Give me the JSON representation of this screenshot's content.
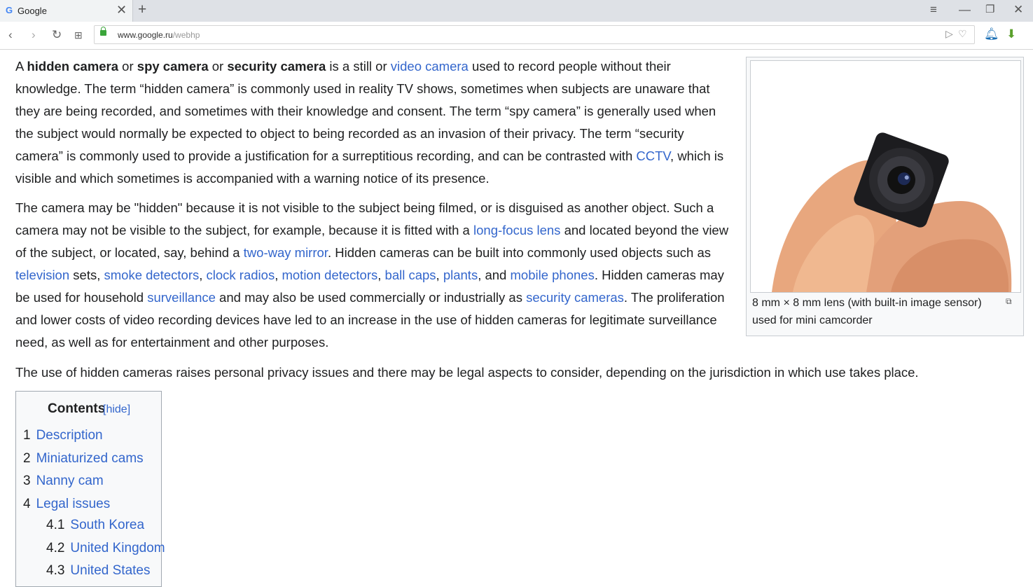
{
  "browser": {
    "tab_title": "Google",
    "tab_favicon": "G",
    "url_host": "www.google.ru",
    "url_path": "/webhp"
  },
  "article": {
    "p1": {
      "s1": "A ",
      "b1": "hidden camera",
      "s2": " or ",
      "b2": "spy camera",
      "s3": " or ",
      "b3": "security camera",
      "s4": " is a still or ",
      "l1": "video camera",
      "s5": " used to record people without their knowledge. The term “hidden camera” is commonly used in reality TV shows, sometimes when subjects are unaware that they are being recorded, and sometimes with their knowledge and consent. The term “spy camera” is generally used when the subject would normally be expected to object to being recorded as an invasion of their privacy. The term “security camera” is commonly used to provide a justification for a surreptitious recording, and can be contrasted with ",
      "l2": "CCTV",
      "s6": ", which is visible and which sometimes is accompanied with a warning notice of its presence."
    },
    "p2": {
      "s1": "The camera may be \"hidden\" because it is not visible to the subject being filmed, or is disguised as another object. Such a camera may not be visible to the subject, for example, because it is fitted with a ",
      "l1": "long-focus lens",
      "s2": " and located beyond the view of the subject, or located, say, behind a ",
      "l2": "two-way mirror",
      "s3": ". Hidden cameras can be built into commonly used objects such as ",
      "l3": "television",
      "s4": " sets, ",
      "l4": "smoke detectors",
      "s5": ", ",
      "l5": "clock radios",
      "s6": ", ",
      "l6": "motion detectors",
      "s7": ", ",
      "l7": "ball caps",
      "s8": ", ",
      "l8": "plants",
      "s9": ", and ",
      "l9": "mobile phones",
      "s10": ". Hidden cameras may be used for household ",
      "l10": "surveillance",
      "s11": " and may also be used commercially or industrially as ",
      "l11": "security cameras",
      "s12": ". The proliferation and lower costs of video recording devices have led to an increase in the use of hidden cameras for legitimate surveillance need, as well as for entertainment and other purposes."
    },
    "p3": "The use of hidden cameras raises personal privacy issues and there may be legal aspects to consider, depending on the jurisdiction in which use takes place."
  },
  "infobox": {
    "caption_line1": "8 mm × 8 mm lens (with built-in image sensor)",
    "caption_line2": "used for mini camcorder"
  },
  "toc": {
    "title": "Contents",
    "hide": "[hide]",
    "items": [
      {
        "num": "1",
        "label": "Description"
      },
      {
        "num": "2",
        "label": "Miniaturized cams"
      },
      {
        "num": "3",
        "label": "Nanny cam"
      },
      {
        "num": "4",
        "label": "Legal issues"
      },
      {
        "num": "4.1",
        "label": "South Korea"
      },
      {
        "num": "4.2",
        "label": "United Kingdom"
      },
      {
        "num": "4.3",
        "label": "United States"
      }
    ]
  }
}
